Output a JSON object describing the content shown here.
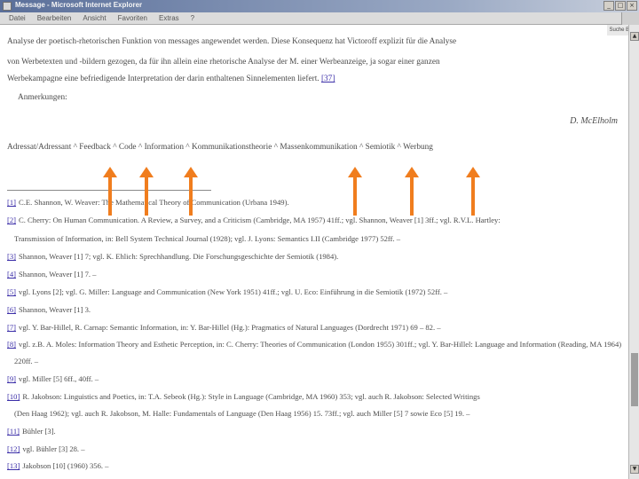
{
  "window": {
    "title": "Message - Microsoft Internet Explorer",
    "controls": [
      "_",
      "□",
      "×"
    ]
  },
  "menubar": {
    "items": [
      "Datei",
      "Bearbeiten",
      "Ansicht",
      "Favoriten",
      "Extras",
      "?"
    ],
    "links_label": "Suche Bem"
  },
  "body": {
    "para_lines": [
      "Analyse der poetisch-rhetorischen Funktion von messages angewendet werden. Diese Konsequenz hat Victoroff explizit für die Analyse",
      "von Werbetexten und -bildern gezogen, da für ihn allein eine rhetorische Analyse der M. einer Werbeanzeige, ja sogar einer ganzen",
      "Werbekampagne eine befriedigende Interpretation der darin enthaltenen Sinnelementen liefert."
    ],
    "para_ref": "[37]",
    "anmerkungen": "Anmerkungen:",
    "signature": "D. McElholm",
    "see_also": "Adressat/Adressant ^ Feedback ^ Code ^ Information ^ Kommunikationstheorie ^ Massenkommunikation ^ Semiotik ^ Werbung"
  },
  "footnotes": [
    {
      "num": "[1]",
      "lines": [
        "C.E. Shannon, W. Weaver: The Mathematical Theory of Communication (Urbana 1949)."
      ]
    },
    {
      "num": "[2]",
      "lines": [
        "C. Cherry: On Human Communication. A Review, a Survey, and a Criticism (Cambridge, MA 1957) 41ff.; vgl. Shannon, Weaver [1] 3ff.; vgl. R.V.L. Hartley:",
        "Transmission of Information, in: Bell System Technical Journal (1928); vgl. J. Lyons: Semantics I.II (Cambridge 1977) 52ff. –"
      ]
    },
    {
      "num": "[3]",
      "lines": [
        "Shannon, Weaver [1] 7; vgl. K. Ehlich: Sprechhandlung. Die Forschungsgeschichte der Semiotik (1984)."
      ]
    },
    {
      "num": "[4]",
      "lines": [
        "Shannon, Weaver [1] 7. –"
      ]
    },
    {
      "num": "[5]",
      "lines": [
        "vgl. Lyons [2]; vgl. G. Miller: Language and Communication (New York 1951) 41ff.; vgl. U. Eco: Einführung in die Semiotik (1972) 52ff. –"
      ]
    },
    {
      "num": "[6]",
      "lines": [
        "Shannon, Weaver [1] 3."
      ]
    },
    {
      "num": "[7]",
      "lines": [
        "vgl. Y. Bar-Hillel, R. Carnap: Semantic Information, in: Y. Bar-Hillel (Hg.): Pragmatics of Natural Languages (Dordrecht 1971) 69 – 82. –"
      ]
    },
    {
      "num": "[8]",
      "lines": [
        "vgl. z.B. A. Moles: Information Theory and Esthetic Perception, in: C. Cherry: Theories of Communication (London 1955) 301ff.; vgl. Y. Bar-Hillel: Language and Information (Reading, MA 1964)",
        "220ff. –"
      ]
    },
    {
      "num": "[9]",
      "lines": [
        "vgl. Miller [5] 6ff., 40ff. –"
      ]
    },
    {
      "num": "[10]",
      "lines": [
        "R. Jakobson: Linguistics and Poetics, in: T.A. Sebeok (Hg.): Style in Language (Cambridge, MA 1960) 353; vgl. auch R. Jakobson: Selected Writings",
        "(Den Haag 1962); vgl. auch R. Jakobson, M. Halle: Fundamentals of Language (Den Haag 1956) 15. 73ff.; vgl. auch Miller [5] 7 sowie Eco [5] 19. –"
      ]
    },
    {
      "num": "[11]",
      "lines": [
        "Bühler [3]."
      ]
    },
    {
      "num": "[12]",
      "lines": [
        "vgl. Bühler [3] 28. –"
      ]
    },
    {
      "num": "[13]",
      "lines": [
        "Jakobson [10] (1960) 356. –"
      ]
    }
  ],
  "accent_color": "#f07d1e",
  "link_color": "#3b2ea8"
}
